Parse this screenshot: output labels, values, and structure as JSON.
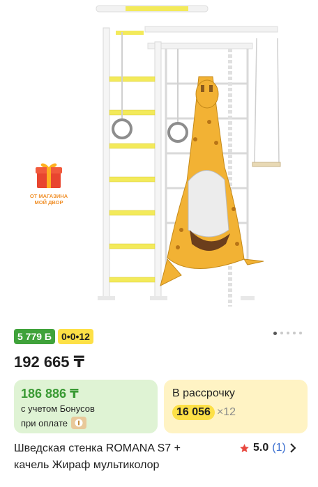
{
  "gallery": {
    "gift_badge": {
      "icon": "gift-icon",
      "line1": "от магазина",
      "line2": "МОЙ ДВОР"
    },
    "image_count": 5,
    "active_image": 1
  },
  "badges": {
    "bonus": "5 779 Б",
    "installment": "0•0•12"
  },
  "price": "192 665 ₸",
  "bonus_card": {
    "price": "186 886 ₸",
    "line1": "с учетом Бонусов",
    "line2": "при оплате",
    "icon": "payment-icon"
  },
  "installment_card": {
    "title": "В рассрочку",
    "amount": "16 056",
    "multiplier": "×12"
  },
  "product": {
    "title_line1": "Шведская стенка ROMANA S7 +",
    "title_line2": "качель Жираф мультиколор",
    "rating": "5.0",
    "reviews": "(1)"
  },
  "colors": {
    "green_badge": "#3fa23a",
    "yellow_badge": "#fde046",
    "bonus_green": "#3a9a34",
    "bonus_card_bg": "#dff3d4",
    "install_card_bg": "#fff3c4",
    "star": "#e8473e",
    "link_blue": "#3b6fd0"
  }
}
